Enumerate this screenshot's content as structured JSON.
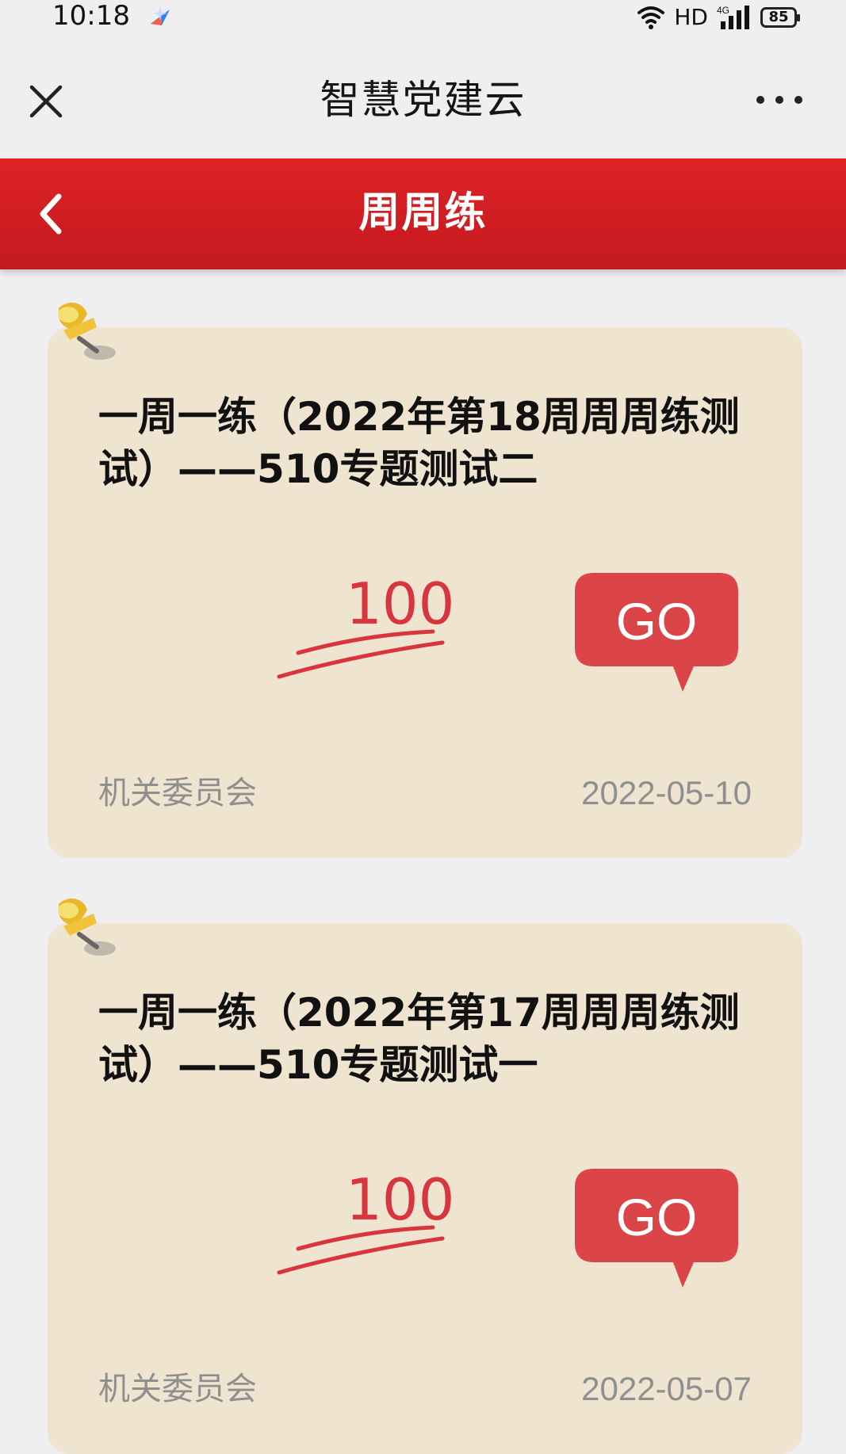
{
  "status_bar": {
    "time": "10:18",
    "network": "HD",
    "signal": "4G",
    "battery": "85"
  },
  "app_bar": {
    "title": "智慧党建云"
  },
  "page_header": {
    "title": "周周练"
  },
  "quizzes": [
    {
      "title": "一周一练（2022年第18周周周练测试）——510专题测试二",
      "score": "100",
      "action": "GO",
      "department": "机关委员会",
      "date": "2022-05-10"
    },
    {
      "title": "一周一练（2022年第17周周周练测试）——510专题测试一",
      "score": "100",
      "action": "GO",
      "department": "机关委员会",
      "date": "2022-05-07"
    }
  ],
  "colors": {
    "header_red": "#d81f24",
    "card_beige": "#eee4d0",
    "score_red": "#d8363c",
    "muted_gray": "#8f8f8f",
    "go_red": "#db4547"
  }
}
